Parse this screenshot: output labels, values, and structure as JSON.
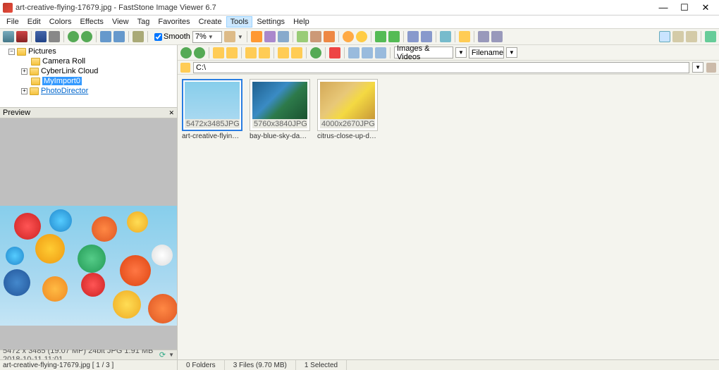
{
  "title": "art-creative-flying-17679.jpg  -  FastStone Image Viewer 6.7",
  "menu": [
    "File",
    "Edit",
    "Colors",
    "Effects",
    "View",
    "Tag",
    "Favorites",
    "Create",
    "Tools",
    "Settings",
    "Help"
  ],
  "menu_active_index": 8,
  "smooth_label": "Smooth",
  "zoom_value": "7%",
  "tree": {
    "root": "Pictures",
    "items": [
      "Camera Roll",
      "CyberLink Cloud",
      "MyImport0",
      "PhotoDirector"
    ],
    "selected_index": 2,
    "link_index": 3
  },
  "preview_label": "Preview",
  "filter1": "Images & Videos",
  "filter2": "Filename",
  "path": "C:\\",
  "thumbs": [
    {
      "dims": "5472x3485",
      "ext": "JPG",
      "name": "art-creative-flying-1...",
      "selected": true,
      "bg": "linear-gradient(#87ceeb,#a8d8f0)"
    },
    {
      "dims": "5760x3840",
      "ext": "JPG",
      "name": "bay-blue-sky-daylig...",
      "selected": false,
      "bg": "linear-gradient(135deg,#1e5f8e,#3a8bc4 40%,#2d7a4a 60%,#1a5230)"
    },
    {
      "dims": "4000x2670",
      "ext": "JPG",
      "name": "citrus-close-up-delic...",
      "selected": false,
      "bg": "linear-gradient(135deg,#d4a958,#e8c878 40%,#f4d942 60%,#c89838)"
    }
  ],
  "info": "5472 x 3485 (19.07 MP)  24bit  JPG  1.91 MB  2018-10-11 11:01",
  "status_path": "art-creative-flying-17679.jpg [ 1 / 3 ]",
  "status_folders": "0 Folders",
  "status_files": "3 Files (9.70 MB)",
  "status_selected": "1 Selected"
}
